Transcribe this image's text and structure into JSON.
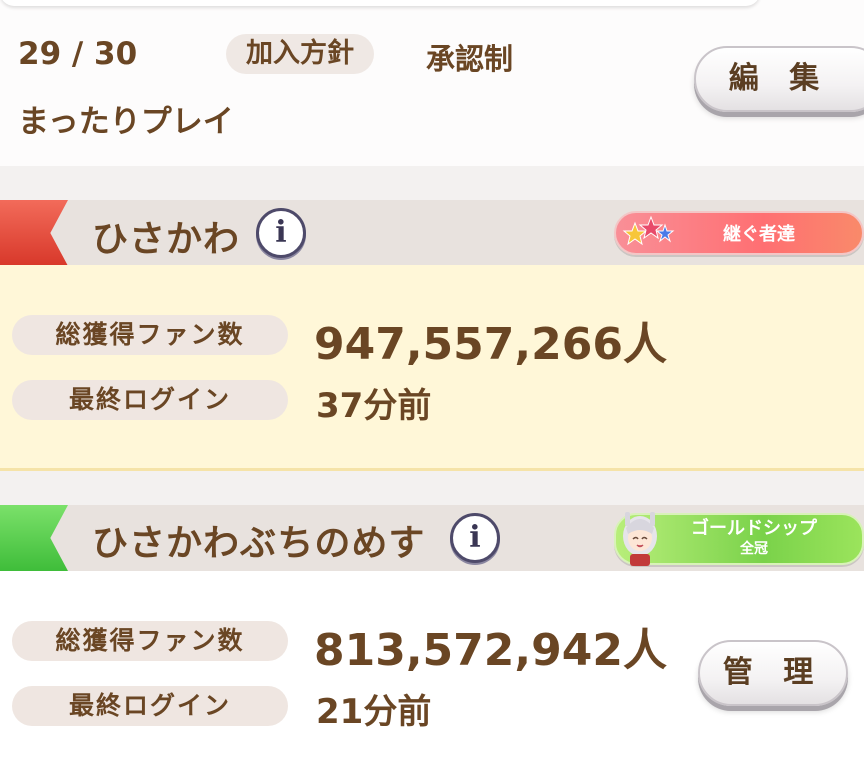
{
  "circle": {
    "members": "29 / 30",
    "policy_label": "加入方針",
    "policy_value": "承認制",
    "style": "まったりプレイ",
    "edit_label": "編 集"
  },
  "members_list": [
    {
      "name": "ひさかわ",
      "title": "継ぐ者達",
      "fans_label": "総獲得ファン数",
      "fans_value": "947,557,266人",
      "login_label": "最終ログイン",
      "login_value": "37分前"
    },
    {
      "name": "ひさかわぶちのめす",
      "title_main": "ゴールドシップ",
      "title_sub": "全冠",
      "fans_label": "総獲得ファン数",
      "fans_value": "813,572,942人",
      "login_label": "最終ログイン",
      "login_value": "21分前",
      "manage_label": "管 理"
    }
  ],
  "icons": {
    "info": "i",
    "info_icon_name": "info-icon",
    "stars_icon_name": "stars-icon",
    "character_icon_name": "character-portrait-icon"
  },
  "colors": {
    "text_brown": "#6a4624",
    "ribbon_red": "#e04a3a",
    "ribbon_green": "#52c947",
    "stats_yellow": "#fff7d8"
  }
}
